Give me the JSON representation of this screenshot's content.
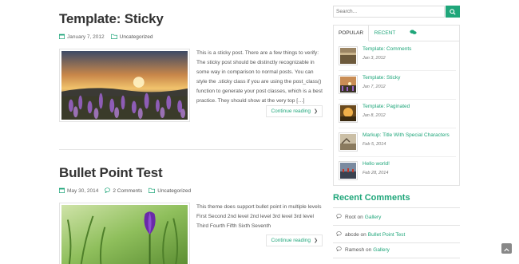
{
  "posts": [
    {
      "title": "Template: Sticky",
      "date": "January 7, 2012",
      "category": "Uncategorized",
      "excerpt": "This is a sticky post. There are a few things to verify: The sticky post should be distinctly recognizable in some way in comparison to normal posts. You can style the .sticky class if you are using the post_class() function to generate your post classes, which is a best practice. They should show at the very top […]",
      "more_label": "Continue reading"
    },
    {
      "title": "Bullet Point Test",
      "date": "May 30, 2014",
      "comments": "2 Comments",
      "category": "Uncategorized",
      "excerpt": "This theme does support bullet point in multiple levels First Second 2nd level 2nd level 3rd level 3rd level Third Fourth Fifth Sixth Seventh",
      "more_label": "Continue reading"
    }
  ],
  "sidebar": {
    "search_placeholder": "Search...",
    "tabs": [
      {
        "label": "POPULAR"
      },
      {
        "label": "RECENT"
      },
      {
        "icon": "comments-icon"
      }
    ],
    "popular": [
      {
        "title": "Template: Comments",
        "date": "Jan 3, 2012"
      },
      {
        "title": "Template: Sticky",
        "date": "Jan 7, 2012"
      },
      {
        "title": "Template: Paginated",
        "date": "Jan 8, 2012"
      },
      {
        "title": "Markup: Title With Special Characters",
        "date": "Feb 5, 2014"
      },
      {
        "title": "Hello world!",
        "date": "Feb 28, 2014"
      }
    ],
    "recent_comments_heading": "Recent Comments",
    "recent_comments": [
      {
        "author": "Root",
        "on": "on",
        "post": "Gallery"
      },
      {
        "author": "abcde",
        "on": "on",
        "post": "Bullet Point Test"
      },
      {
        "author": "Ramesh",
        "on": "on",
        "post": "Gallery"
      }
    ]
  },
  "colors": {
    "accent": "#1fa67a",
    "text": "#555555",
    "heading": "#333333"
  }
}
